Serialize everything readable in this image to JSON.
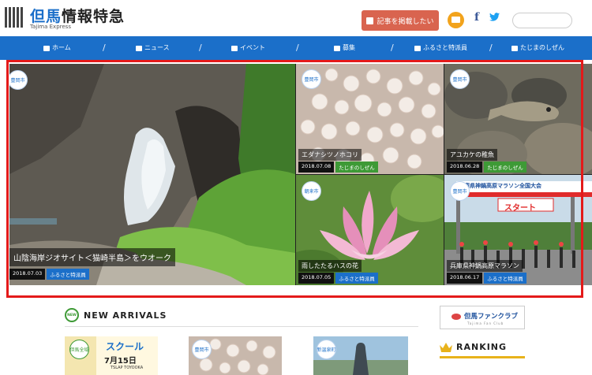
{
  "header": {
    "logo_title_accent": "但馬",
    "logo_title_rest": "情報特急",
    "logo_sub": "Tajima Express",
    "post_button": "記事を掲載したい",
    "facebook_glyph": "f",
    "search_placeholder": ""
  },
  "nav": [
    {
      "label": "ホーム",
      "icon": "home-icon"
    },
    {
      "label": "ニュース",
      "icon": "newspaper-icon"
    },
    {
      "label": "イベント",
      "icon": "calendar-icon"
    },
    {
      "label": "募集",
      "icon": "users-icon"
    },
    {
      "label": "ふるさと特派員",
      "icon": "id-card-icon"
    },
    {
      "label": "たじまのしぜん",
      "icon": "leaf-icon"
    }
  ],
  "hero": {
    "main": {
      "city": "豊岡市",
      "title": "山陰海岸ジオサイト＜猫崎半島＞をウオーク",
      "date": "2018.07.03",
      "tag": "ふるさと特派員"
    },
    "tiles": [
      {
        "city": "豊岡市",
        "title": "エダナシツノホコリ",
        "date": "2018.07.08",
        "tag": "たじまのしぜん"
      },
      {
        "city": "豊岡市",
        "title": "アユカケの稚魚",
        "date": "2018.06.28",
        "tag": "たじまのしぜん"
      },
      {
        "city": "朝来市",
        "title": "雨したたるハスの花",
        "date": "2018.07.05",
        "tag": "ふるさと特派員"
      },
      {
        "city": "豊岡市",
        "title": "兵庫県神鍋高原マラソン",
        "date": "2018.06.17",
        "tag": "ふるさと特派員"
      }
    ],
    "banner_start": "スタート",
    "banner_sign": "兵庫県神鍋高原マラソン全国大会"
  },
  "arrivals": {
    "badge": "NEW",
    "title": "NEW ARRIVALS",
    "thumbs": [
      {
        "city": "但馬全域",
        "text": "スクール",
        "date": "7月15日",
        "sub": "TSLAP TOYOOKA"
      },
      {
        "city": "豊岡市"
      },
      {
        "city": "新温泉町"
      }
    ]
  },
  "sidebar": {
    "fan_club": "但馬ファンクラブ",
    "fan_club_sub": "Tajima Fan Club",
    "ranking": "RANKING"
  },
  "colors": {
    "brand": "#1b6fc9",
    "accent_red": "#e41a1a",
    "post_button": "#d9644f",
    "mail": "#f2a31c"
  }
}
